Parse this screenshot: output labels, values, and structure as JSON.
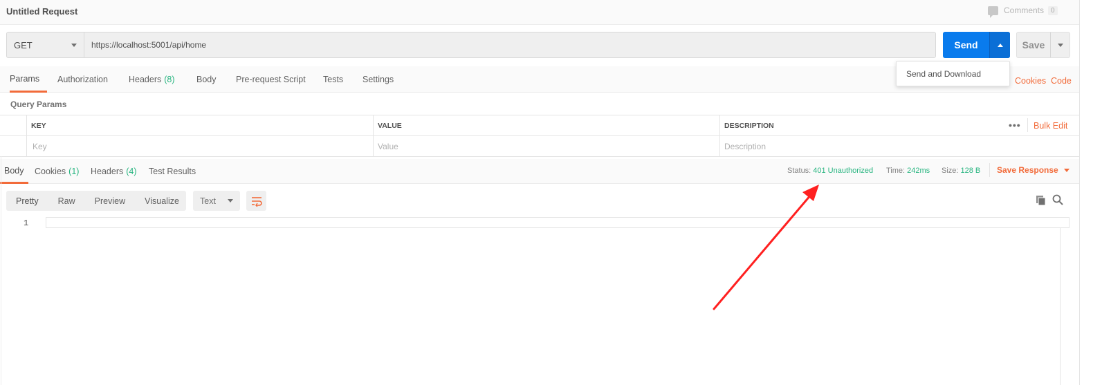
{
  "header": {
    "title": "Untitled Request",
    "comments_label": "Comments",
    "comments_count": "0"
  },
  "request": {
    "method": "GET",
    "url": "https://localhost:5001/api/home",
    "send_label": "Send",
    "save_label": "Save",
    "send_menu": [
      "Send and Download"
    ]
  },
  "request_tabs": [
    {
      "label": "Params",
      "count": ""
    },
    {
      "label": "Authorization",
      "count": ""
    },
    {
      "label": "Headers",
      "count": "(8)"
    },
    {
      "label": "Body",
      "count": ""
    },
    {
      "label": "Pre-request Script",
      "count": ""
    },
    {
      "label": "Tests",
      "count": ""
    },
    {
      "label": "Settings",
      "count": ""
    }
  ],
  "request_links": {
    "cookies": "Cookies",
    "code": "Code"
  },
  "query_params": {
    "title": "Query Params",
    "columns": [
      "KEY",
      "VALUE",
      "DESCRIPTION"
    ],
    "placeholders": [
      "Key",
      "Value",
      "Description"
    ],
    "more": "•••",
    "bulk_edit": "Bulk Edit"
  },
  "response_tabs": [
    {
      "label": "Body",
      "count": ""
    },
    {
      "label": "Cookies",
      "count": "(1)"
    },
    {
      "label": "Headers",
      "count": "(4)"
    },
    {
      "label": "Test Results",
      "count": ""
    }
  ],
  "response_meta": {
    "status_label": "Status:",
    "status_value": "401 Unauthorized",
    "time_label": "Time:",
    "time_value": "242ms",
    "size_label": "Size:",
    "size_value": "128 B",
    "save_response": "Save Response"
  },
  "viewer": {
    "modes": [
      "Pretty",
      "Raw",
      "Preview",
      "Visualize"
    ],
    "format": "Text",
    "line_number": "1"
  },
  "colors": {
    "accent": "#f26b3a",
    "send_blue": "#097bed",
    "success_green": "#26b47f",
    "annotation_red": "#ff2020"
  },
  "icons": [
    "comment-icon",
    "chevron-down-icon",
    "chevron-up-icon",
    "wrap-lines-icon",
    "copy-icon",
    "search-icon"
  ]
}
